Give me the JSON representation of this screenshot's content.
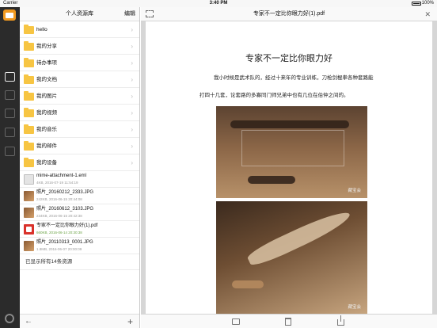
{
  "status": {
    "carrier": "Carrier",
    "time": "3:40 PM",
    "battery": "100%"
  },
  "panel": {
    "title": "个人资源库",
    "edit_label": "编辑",
    "folders": [
      {
        "label": "hello"
      },
      {
        "label": "我的分享"
      },
      {
        "label": "待办事项"
      },
      {
        "label": "我的文档"
      },
      {
        "label": "我的图片"
      },
      {
        "label": "我的视频"
      },
      {
        "label": "我的音乐"
      },
      {
        "label": "我的邮件"
      },
      {
        "label": "我的设备"
      }
    ],
    "files": [
      {
        "name": "mime-attachment-1.eml",
        "meta": "4KB, 2016-07-19 11:54:19",
        "type": "doc"
      },
      {
        "name": "照片_20160212_2333.JPG",
        "meta": "242KB, 2016-06-15 20:44:08",
        "type": "img"
      },
      {
        "name": "照片_20160612_3103.JPG",
        "meta": "234KB, 2016-06-15 20:42:38",
        "type": "img"
      },
      {
        "name": "专家不一定比你眼力好(1).pdf",
        "meta": "660KB, 2016-06-14 20:30:38",
        "type": "pdf"
      },
      {
        "name": "照片_20110313_0001.JPG",
        "meta": "1.8MB, 2016-06-07 20:00:09",
        "type": "img"
      }
    ],
    "summary": "已显示所有14条资源",
    "back_icon": "arrow-left-icon",
    "add_icon": "plus-icon"
  },
  "viewer": {
    "title": "专家不一定比你眼力好(1).pdf",
    "doc_title": "专家不一定比你眼力好",
    "para1": "我小时候是武术队的，经过十来年的专业训练，刀枪剑棍拳各种套路能",
    "para2": "打四十几套，论套路的多寡同门师兄弟中也有几位在伯仲之间的。",
    "watermark1": "藏宝会",
    "watermark2": "藏宝会"
  }
}
